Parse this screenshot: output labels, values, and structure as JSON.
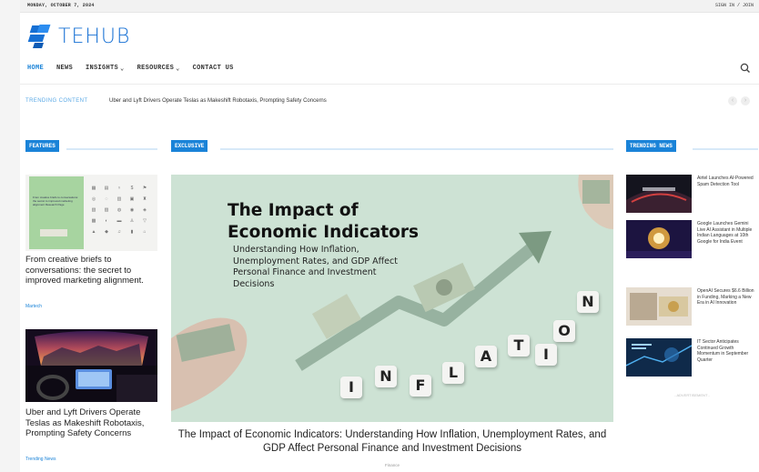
{
  "topbar": {
    "date": "MONDAY, OCTOBER 7, 2024",
    "sign": "SIGN IN / JOIN"
  },
  "logo": {
    "text": "TEHUB"
  },
  "nav": {
    "items": [
      {
        "label": "HOME",
        "active": true
      },
      {
        "label": "NEWS"
      },
      {
        "label": "INSIGHTS",
        "dropdown": true
      },
      {
        "label": "RESOURCES",
        "dropdown": true
      },
      {
        "label": "CONTACT US"
      }
    ],
    "search_icon": "search-icon"
  },
  "trending_bar": {
    "label": "TRENDING CONTENT",
    "headline": "Uber and Lyft Drivers Operate Teslas as Makeshift Robotaxis, Prompting Safety Concerns",
    "prev": "‹",
    "next": "›"
  },
  "features": {
    "header": "FEATURES",
    "posts": [
      {
        "title": "From creative briefs to conversations: the secret to improved marketing alignment.",
        "category": "Martech",
        "image_text": "From creative briefs to conversations: the secret to improved marketing alignment Research Page"
      },
      {
        "title": "Uber and Lyft Drivers Operate Teslas as Makeshift Robotaxis, Prompting Safety Concerns",
        "category": "Trending News"
      }
    ]
  },
  "exclusive": {
    "header": "EXCLUSIVE",
    "image_heading_1": "The Impact of",
    "image_heading_2": "Economic Indicators",
    "image_subheading": "Understanding How Inflation, Unemployment Rates, and GDP Affect Personal Finance and Investment Decisions",
    "dice_letters": [
      "I",
      "N",
      "F",
      "L",
      "A",
      "T",
      "I",
      "O",
      "N"
    ],
    "title": "The Impact of Economic Indicators: Understanding How Inflation, Unemployment Rates, and GDP Affect Personal Finance and Investment Decisions",
    "category": "Finance"
  },
  "trending_news": {
    "header": "TRENDING NEWS",
    "items": [
      {
        "title": "Airtel Launches AI-Powered Spam Detection Tool"
      },
      {
        "title": "Google Launches Gemini Live AI Assistant in Multiple Indian Languages at 10th Google for India Event"
      },
      {
        "title": "OpenAI Secures $6.6 Billion in Funding, Marking a New Era in AI Innovation"
      },
      {
        "title": "IT Sector Anticipates Continued Growth Momentum in September Quarter"
      }
    ],
    "advertisement": "- ADVERTISEMENT -"
  },
  "colors": {
    "accent": "#1a83d8",
    "logo": "#1670d4"
  }
}
